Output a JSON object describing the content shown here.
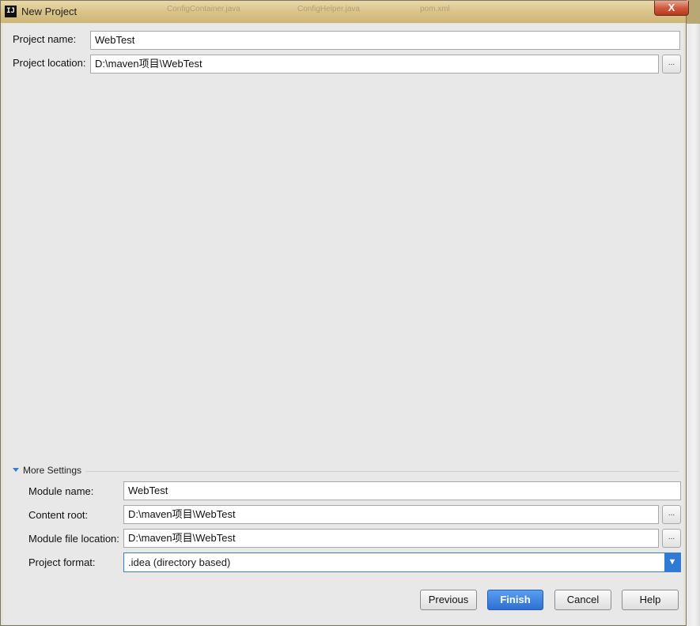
{
  "window": {
    "title": "New Project",
    "close_glyph": "X",
    "background_tabs": [
      "ConfigContainer.java",
      "ConfigHelper.java",
      "pom.xml"
    ]
  },
  "form": {
    "project_name_label": "Project name:",
    "project_name_value": "WebTest",
    "project_location_label": "Project location:",
    "project_location_value": "D:\\maven项目\\WebTest",
    "browse_label": "..."
  },
  "more_settings": {
    "toggle_label": "More Settings",
    "module_name_label": "Module name:",
    "module_name_value": "WebTest",
    "content_root_label": "Content root:",
    "content_root_value": "D:\\maven项目\\WebTest",
    "module_file_location_label": "Module file location:",
    "module_file_location_value": "D:\\maven项目\\WebTest",
    "project_format_label": "Project format:",
    "project_format_value": ".idea (directory based)"
  },
  "buttons": {
    "previous": "Previous",
    "finish": "Finish",
    "cancel": "Cancel",
    "help": "Help"
  },
  "colors": {
    "accent": "#2f7ad6",
    "title_bar": "#d8c287",
    "close_button": "#cf5a3f"
  }
}
